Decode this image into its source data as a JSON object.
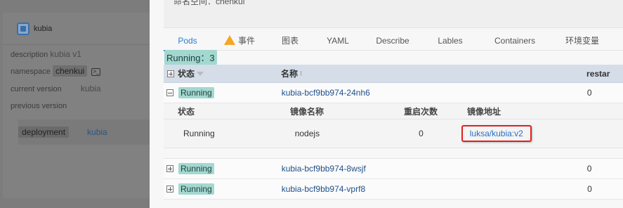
{
  "left": {
    "app_name": "kubia",
    "description_label": "description",
    "description_value": "kubia v1",
    "namespace_label": "namespace",
    "namespace_value": "chenkui",
    "current_version_label": "current version",
    "current_version_value": "kubia",
    "previous_version_label": "previous version",
    "deployment_tag": "deployment",
    "deployment_link": "kubia"
  },
  "drawer": {
    "top_text": "命名空间：chenkui",
    "tabs": [
      {
        "label": "Pods",
        "active": true
      },
      {
        "label": "事件",
        "icon": "warning-icon"
      },
      {
        "label": "图表"
      },
      {
        "label": "YAML"
      },
      {
        "label": "Describe"
      },
      {
        "label": "Lables"
      },
      {
        "label": "Containers"
      },
      {
        "label": "环境变量"
      }
    ],
    "running_count": "Running：3"
  },
  "table": {
    "headers": {
      "status": "状态",
      "name": "名称",
      "restarts": "restar"
    },
    "rows": [
      {
        "status": "Running",
        "name": "kubia-bcf9bb974-24nh6",
        "restarts": "0",
        "expanded": true
      },
      {
        "status": "Running",
        "name": "kubia-bcf9bb974-8wsjf",
        "restarts": "0",
        "expanded": false
      },
      {
        "status": "Running",
        "name": "kubia-bcf9bb974-vprf8",
        "restarts": "0",
        "expanded": false
      }
    ],
    "sub": {
      "headers": {
        "status": "状态",
        "image_name": "镜像名称",
        "restart_count": "重启次数",
        "image_addr": "镜像地址"
      },
      "row": {
        "status": "Running",
        "image_name": "nodejs",
        "restart_count": "0",
        "image_addr": "luksa/kubia:v2"
      }
    }
  },
  "colors": {
    "accent": "#2c7cd1",
    "status_bg": "#a3d8d0",
    "highlight_border": "#e02020",
    "warning": "#f5a623"
  }
}
